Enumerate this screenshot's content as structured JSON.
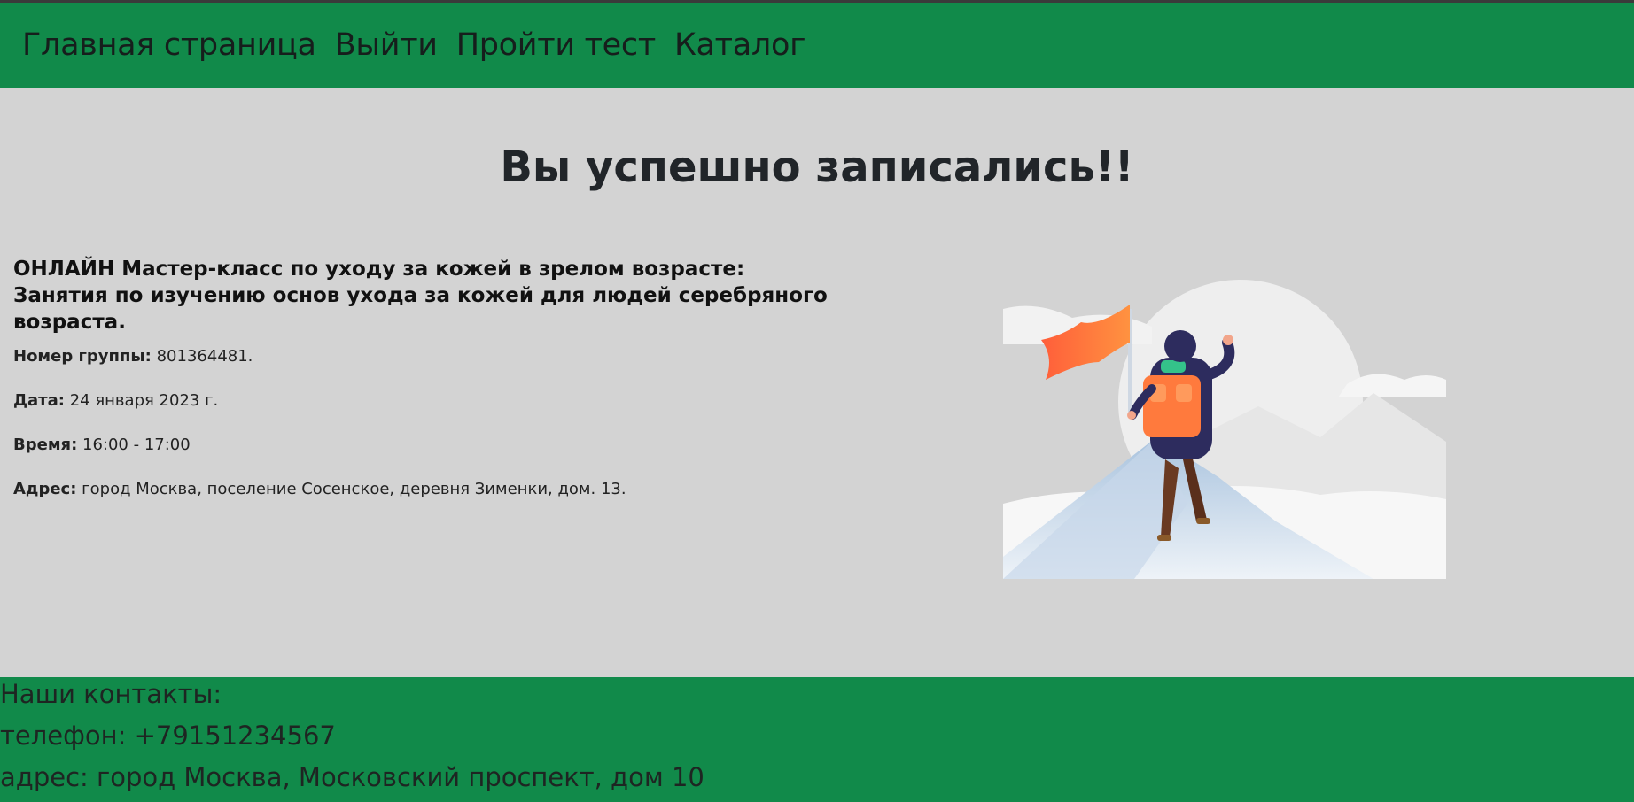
{
  "nav": {
    "items": [
      {
        "label": "Главная страница"
      },
      {
        "label": "Выйти"
      },
      {
        "label": "Пройти тест"
      },
      {
        "label": "Каталог"
      }
    ]
  },
  "main": {
    "title": "Вы успешно записались!!",
    "event": {
      "title": "ОНЛАЙН Мастер-класс по уходу за кожей в зрелом возрасте: Занятия по изучению основ ухода за кожей для людей серебряного возраста.",
      "group_label": "Номер группы:",
      "group_value": "801364481.",
      "date_label": "Дата:",
      "date_value": "24 января 2023 г.",
      "time_label": "Время:",
      "time_value": "16:00 - 17:00",
      "address_label": "Адрес:",
      "address_value": "город Москва, поселение Сосенское, деревня Зименки, дом. 13."
    },
    "illustration": "hiker-with-flag-on-mountain-peak"
  },
  "footer": {
    "contacts_title": "Наши контакты:",
    "phone": "телефон: +79151234567",
    "address": "адрес: город Москва, Московский проспект, дом 10"
  },
  "colors": {
    "header_bg": "#118a4a",
    "page_bg": "#d3d3d3",
    "flag": "#ff7a3d"
  }
}
